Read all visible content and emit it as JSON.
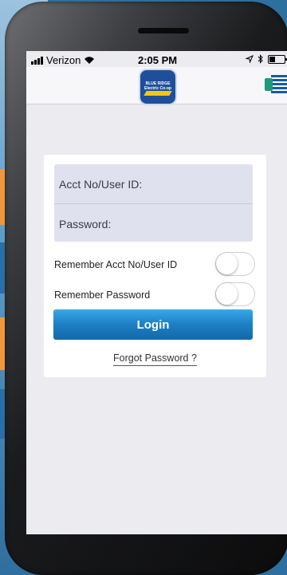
{
  "status_bar": {
    "carrier": "Verizon",
    "time": "2:05 PM",
    "icons": [
      "signal-icon",
      "wifi-icon",
      "location-icon",
      "bluetooth-icon",
      "battery-icon"
    ]
  },
  "header": {
    "logo_text": "BLUE RIDGE Electric Co-op",
    "menu_icon": "menu-icon"
  },
  "login_form": {
    "username_label": "Acct No/User ID:",
    "password_label": "Password:",
    "remember_user_label": "Remember Acct No/User ID",
    "remember_user_on": false,
    "remember_password_label": "Remember Password",
    "remember_password_on": false,
    "login_label": "Login",
    "forgot_label": "Forgot Password ?"
  },
  "colors": {
    "accent": "#1d7fc4",
    "logo_blue": "#1f4f9a",
    "bolt_yellow": "#f6c518"
  }
}
